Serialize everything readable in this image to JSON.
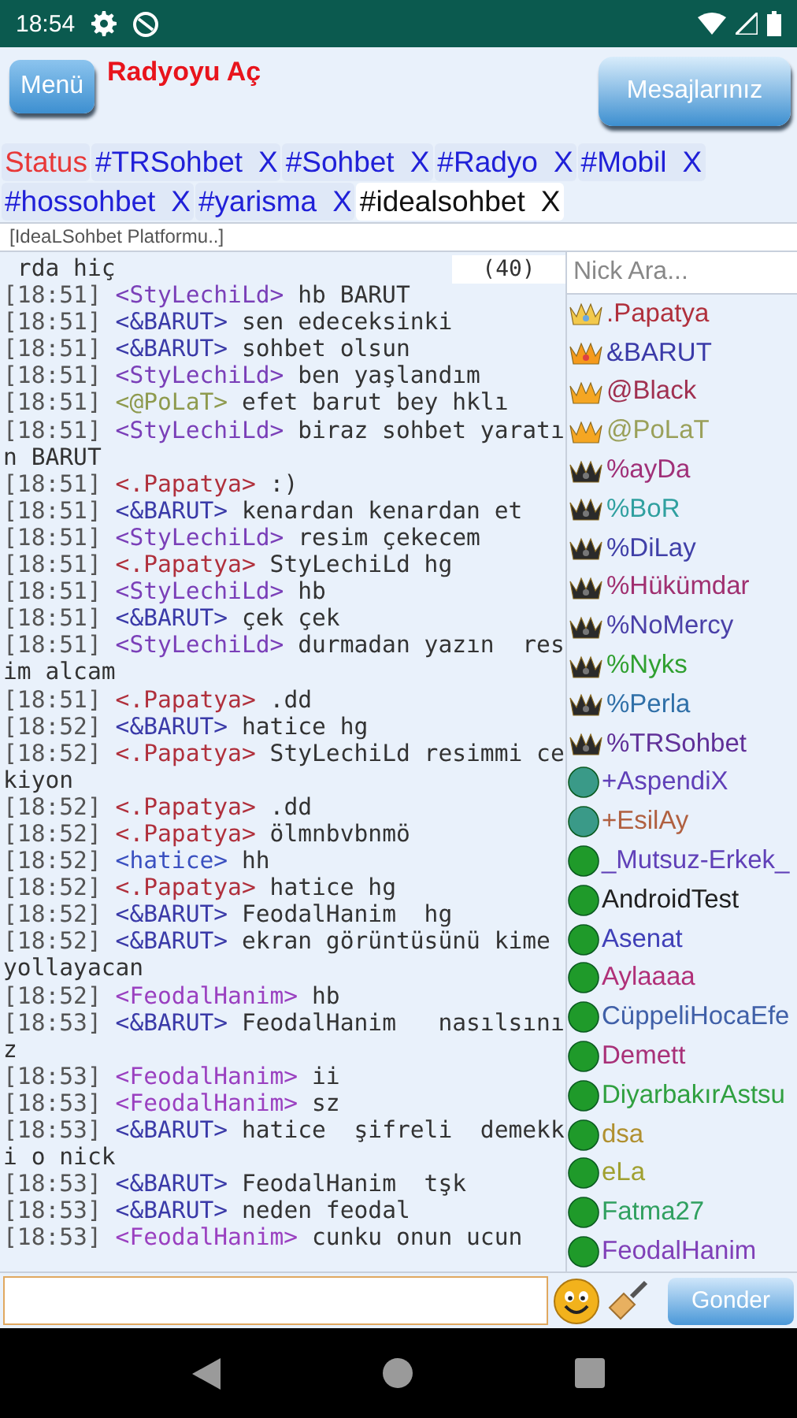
{
  "status_bar": {
    "time": "18:54"
  },
  "header": {
    "menu_button": "Menü",
    "radio_link": "Radyoyu Aç",
    "messages_button": "Mesajlarınız"
  },
  "tabs": [
    {
      "label": "Status",
      "kind": "status",
      "selected": false
    },
    {
      "label": "#TRSohbet",
      "kind": "channel",
      "close": "X",
      "selected": false
    },
    {
      "label": "#Sohbet",
      "kind": "channel",
      "close": "X",
      "selected": false
    },
    {
      "label": "#Radyo",
      "kind": "channel",
      "close": "X",
      "selected": false
    },
    {
      "label": "#Mobil",
      "kind": "channel",
      "close": "X",
      "selected": false
    },
    {
      "label": "#hossohbet",
      "kind": "channel",
      "close": "X",
      "selected": false
    },
    {
      "label": "#yarisma",
      "kind": "channel",
      "close": "X",
      "selected": false
    },
    {
      "label": "#idealsohbet",
      "kind": "channel",
      "close": "X",
      "selected": true
    }
  ],
  "topic": "[IdeaLSohbet Platformu..]",
  "user_count": "(40)",
  "messages": [
    {
      "text": "rda hiç"
    },
    {
      "time": "[18:51]",
      "nick": "<StyLechiLd>",
      "color": "#7a3fb8",
      "text": "hb BARUT"
    },
    {
      "time": "[18:51]",
      "nick": "<&BARUT>",
      "color": "#3a3aa8",
      "text": "sen edeceksinki"
    },
    {
      "time": "[18:51]",
      "nick": "<&BARUT>",
      "color": "#3a3aa8",
      "text": "sohbet olsun"
    },
    {
      "time": "[18:51]",
      "nick": "<StyLechiLd>",
      "color": "#7a3fb8",
      "text": "ben yaşlandım"
    },
    {
      "time": "[18:51]",
      "nick": "<@PoLaT>",
      "color": "#8e9a4e",
      "text": "efet barut bey hklı"
    },
    {
      "time": "[18:51]",
      "nick": "<StyLechiLd>",
      "color": "#7a3fb8",
      "text": "biraz sohbet yaratın BARUT"
    },
    {
      "time": "[18:51]",
      "nick": "<.Papatya>",
      "color": "#b0303c",
      "text": ":)"
    },
    {
      "time": "[18:51]",
      "nick": "<&BARUT>",
      "color": "#3a3aa8",
      "text": "kenardan kenardan et"
    },
    {
      "time": "[18:51]",
      "nick": "<StyLechiLd>",
      "color": "#7a3fb8",
      "text": "resim çekecem"
    },
    {
      "time": "[18:51]",
      "nick": "<.Papatya>",
      "color": "#b0303c",
      "text": "StyLechiLd hg"
    },
    {
      "time": "[18:51]",
      "nick": "<StyLechiLd>",
      "color": "#7a3fb8",
      "text": "hb"
    },
    {
      "time": "[18:51]",
      "nick": "<&BARUT>",
      "color": "#3a3aa8",
      "text": "çek çek"
    },
    {
      "time": "[18:51]",
      "nick": "<StyLechiLd>",
      "color": "#7a3fb8",
      "text": "durmadan yazın  resim alcam"
    },
    {
      "time": "[18:51]",
      "nick": "<.Papatya>",
      "color": "#b0303c",
      "text": ".dd"
    },
    {
      "time": "[18:52]",
      "nick": "<&BARUT>",
      "color": "#3a3aa8",
      "text": "hatice hg"
    },
    {
      "time": "[18:52]",
      "nick": "<.Papatya>",
      "color": "#b0303c",
      "text": "StyLechiLd resimmi cekiyon"
    },
    {
      "time": "[18:52]",
      "nick": "<.Papatya>",
      "color": "#b0303c",
      "text": ".dd"
    },
    {
      "time": "[18:52]",
      "nick": "<.Papatya>",
      "color": "#b0303c",
      "text": "ölmnbvbnmö"
    },
    {
      "time": "[18:52]",
      "nick": "<hatice>",
      "color": "#3a50c0",
      "text": "hh"
    },
    {
      "time": "[18:52]",
      "nick": "<.Papatya>",
      "color": "#b0303c",
      "text": "hatice hg"
    },
    {
      "time": "[18:52]",
      "nick": "<&BARUT>",
      "color": "#3a3aa8",
      "text": "FeodalHanim  hg"
    },
    {
      "time": "[18:52]",
      "nick": "<&BARUT>",
      "color": "#3a3aa8",
      "text": "ekran görüntüsünü kime yollayacan"
    },
    {
      "time": "[18:52]",
      "nick": "<FeodalHanim>",
      "color": "#9a40c0",
      "text": "hb"
    },
    {
      "time": "[18:53]",
      "nick": "<&BARUT>",
      "color": "#3a3aa8",
      "text": "FeodalHanim   nasılsınız"
    },
    {
      "time": "[18:53]",
      "nick": "<FeodalHanim>",
      "color": "#9a40c0",
      "text": "ii"
    },
    {
      "time": "[18:53]",
      "nick": "<FeodalHanim>",
      "color": "#9a40c0",
      "text": "sz"
    },
    {
      "time": "[18:53]",
      "nick": "<&BARUT>",
      "color": "#3a3aa8",
      "text": "hatice  şifreli  demekki o nick"
    },
    {
      "time": "[18:53]",
      "nick": "<&BARUT>",
      "color": "#3a3aa8",
      "text": "FeodalHanim  tşk"
    },
    {
      "time": "[18:53]",
      "nick": "<&BARUT>",
      "color": "#3a3aa8",
      "text": "neden feodal"
    },
    {
      "time": "[18:53]",
      "nick": "<FeodalHanim>",
      "color": "#9a40c0",
      "text": "cunku onun ucun"
    }
  ],
  "nick_search": {
    "placeholder": "Nick Ara..."
  },
  "nicks": [
    {
      "name": ".Papatya",
      "kind": "owner",
      "color": "#b0303c"
    },
    {
      "name": "&BARUT",
      "kind": "admin",
      "color": "#3a3aa8"
    },
    {
      "name": "@Black",
      "kind": "op",
      "color": "#a03050"
    },
    {
      "name": "@PoLaT",
      "kind": "op",
      "color": "#9aa05a"
    },
    {
      "name": "%ayDa",
      "kind": "halfop",
      "color": "#a03078"
    },
    {
      "name": "%BoR",
      "kind": "halfop",
      "color": "#30a0a0"
    },
    {
      "name": "%DiLay",
      "kind": "halfop",
      "color": "#4040a8"
    },
    {
      "name": "%Hükümdar",
      "kind": "halfop",
      "color": "#a03070"
    },
    {
      "name": "%NoMercy",
      "kind": "halfop",
      "color": "#4a40a8"
    },
    {
      "name": "%Nyks",
      "kind": "halfop",
      "color": "#30a030"
    },
    {
      "name": "%Perla",
      "kind": "halfop",
      "color": "#3070a8"
    },
    {
      "name": "%TRSohbet",
      "kind": "halfop",
      "color": "#603098"
    },
    {
      "name": "+AspendiX",
      "kind": "voice",
      "color": "#6040b8"
    },
    {
      "name": "+EsilAy",
      "kind": "voice",
      "color": "#b06040"
    },
    {
      "name": "_Mutsuz-Erkek_",
      "kind": "user",
      "color": "#6040b8"
    },
    {
      "name": "AndroidTest",
      "kind": "user",
      "color": "#202020"
    },
    {
      "name": "Asenat",
      "kind": "user",
      "color": "#4040b8"
    },
    {
      "name": "Aylaaaa",
      "kind": "user",
      "color": "#b03078"
    },
    {
      "name": "CüppeliHocaEfe",
      "kind": "user",
      "color": "#4060a8"
    },
    {
      "name": "Demett",
      "kind": "user",
      "color": "#a83078"
    },
    {
      "name": "DiyarbakırAstsu",
      "kind": "user",
      "color": "#30a040"
    },
    {
      "name": "dsa",
      "kind": "user",
      "color": "#b09030"
    },
    {
      "name": "eLa",
      "kind": "user",
      "color": "#a0a030"
    },
    {
      "name": "Fatma27",
      "kind": "user",
      "color": "#30a060"
    },
    {
      "name": "FeodalHanim",
      "kind": "user",
      "color": "#8040b8"
    }
  ],
  "composer": {
    "send_button": "Gonder"
  }
}
